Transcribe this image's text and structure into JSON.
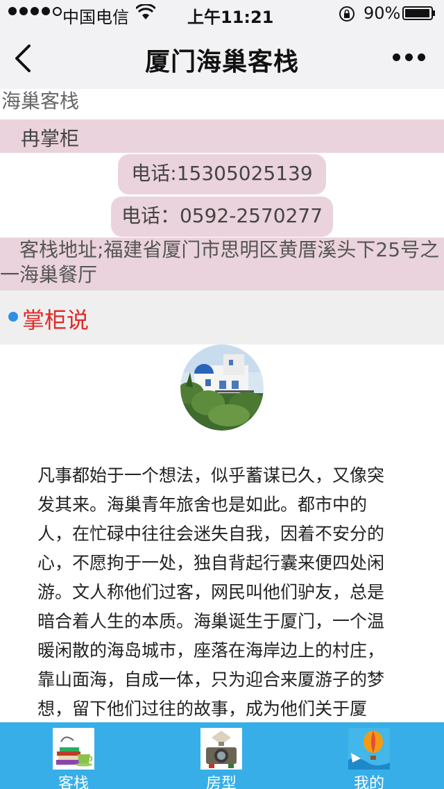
{
  "status_bar": {
    "carrier": "中国电信",
    "time": "上午11:21",
    "battery": "90%"
  },
  "nav": {
    "title": "厦门海巢客栈"
  },
  "info": {
    "inn_name": "海巢客栈",
    "manager": "冉掌柜",
    "phone1": "电话:15305025139",
    "phone2": "电话：0592-2570277",
    "address": "客栈地址;福建省厦门市思明区黄厝溪头下25号之一海巢餐厅"
  },
  "section": {
    "title": "掌柜说"
  },
  "article": {
    "text": "凡事都始于一个想法，似乎蓄谋已久，又像突发其来。海巢青年旅舍也是如此。都市中的人，在忙碌中往往会迷失自我，因着不安分的心，不愿拘于一处，独自背起行囊来便四处闲游。文人称他们过客，网民叫他们驴友，总是暗合着人生的本质。海巢诞生于厦门，一个温暖闲散的海岛城市，座落在海岸边上的村庄，靠山面海，自成一体，只为迎合来厦游子的梦想，留下他们过往的故事，成为他们关于厦门，关于海与巢的回忆。"
  },
  "tabs": [
    {
      "label": "客栈",
      "icon": "books-teacup-icon"
    },
    {
      "label": "房型",
      "icon": "vintage-camera-icon"
    },
    {
      "label": "我的",
      "icon": "hot-air-balloon-icon"
    }
  ],
  "colors": {
    "header_bg": "#f2f2f4",
    "pink_highlight": "#ead3dc",
    "section_title": "#e02828",
    "bullet": "#2f8fe6",
    "tabbar_bg": "#37aee8"
  }
}
